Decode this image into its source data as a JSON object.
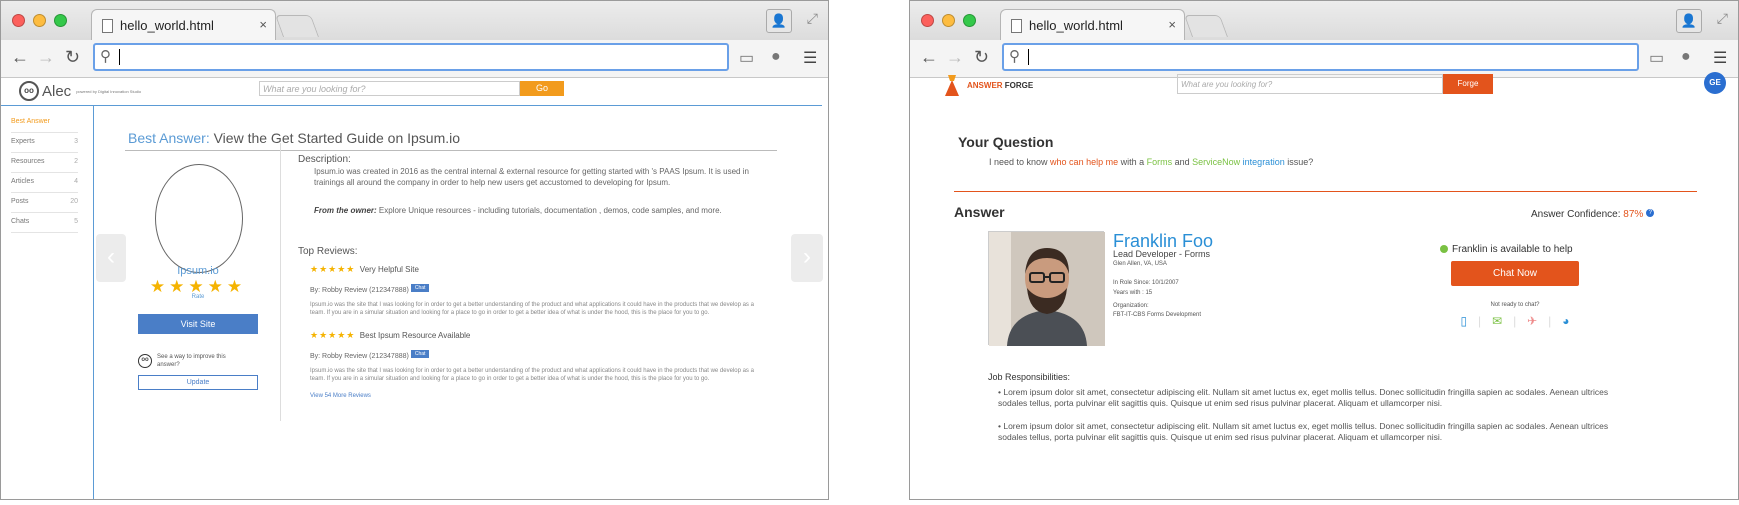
{
  "browser": {
    "tab_title": "hello_world.html",
    "tab_close": "×"
  },
  "alec": {
    "logo_name": "Alec",
    "logo_tagline": "powered by Digital Innovation Studio",
    "search_placeholder": "What are you looking for?",
    "go_label": "Go",
    "sidebar": [
      {
        "label": "Best Answer",
        "count": ""
      },
      {
        "label": "Experts",
        "count": "3"
      },
      {
        "label": "Resources",
        "count": "2"
      },
      {
        "label": "Articles",
        "count": "4"
      },
      {
        "label": "Posts",
        "count": "20"
      },
      {
        "label": "Chats",
        "count": "5"
      }
    ],
    "title_prefix": "Best Answer:",
    "title_main": " View the Get Started Guide on Ipsum.io",
    "resource_name": "Ipsum.io",
    "rating_stars": "★★★★★",
    "rating": 5,
    "rate_label": "Rate",
    "visit_label": "Visit Site",
    "improve_text": "See a way to improve this answer?",
    "update_label": "Update",
    "description_heading": "Description:",
    "description_body": "Ipsum.io was created in 2016 as the central internal & external resource for getting started with 's PAAS Ipsum.  It is used in trainings all around the company in order to help new users get accustomed to developing for Ipsum.",
    "owner_label": "From the owner:",
    "owner_text": " Explore Unique resources - including tutorials, documentation , demos, code samples, and more.",
    "reviews_heading": "Top Reviews:",
    "reviews": [
      {
        "stars": "★★★★★",
        "title": "Very Helpful Site",
        "by": "By: Robby Review (212347888)",
        "chat": "Chat",
        "body": "Ipsum.io was the site that I was looking for in order to get a better understanding of the product and what applications it could have in the products that we develop as a team.  If you are in a simular situation and looking for a place to go in order to get a better idea of what is under the hood, this is the place for you to go."
      },
      {
        "stars": "★★★★★",
        "title": "Best Ipsum Resource Available",
        "by": "By: Robby Review (212347888)",
        "chat": "Chat",
        "body": "Ipsum.io was the site that I was looking for in order to get a better understanding of the product and what applications it could have in the products that we develop as a team.  If you are in a simular situation and looking for a place to go in order to get a better idea of what is under the hood, this is the place for you to go."
      }
    ],
    "more_reviews": "View 54 More Reviews"
  },
  "forge": {
    "logo_a": "ANSWER",
    "logo_b": " FORGE",
    "search_placeholder": "What are you looking for?",
    "forge_label": "Forge",
    "ge_logo": "GE",
    "question_heading": "Your Question",
    "question": {
      "p1": "I need to know ",
      "p2": "who can help me",
      "p3": " with a ",
      "p4": "Forms",
      "p5": " and ",
      "p6": "ServiceNow",
      "p7": " ",
      "p8": "integration",
      "p9": " issue?"
    },
    "answer_heading": "Answer",
    "confidence_label": "Answer Confidence: ",
    "confidence_value": "87%",
    "help_glyph": "?",
    "expert": {
      "name": "Franklin Foo",
      "role": "Lead Developer -  Forms",
      "location": "Glen Allen, VA, USA",
      "in_role_since": "In Role Since: 10/1/2007",
      "years_with": "Years with : 15",
      "org_label": "Organization:",
      "org_value": "FBT-IT-CBS Forms Development"
    },
    "availability": "Franklin is available to help",
    "chat_now": "Chat Now",
    "not_ready": "Not ready to chat?",
    "contact_icons": [
      "phone-icon",
      "email-icon",
      "messenger-icon",
      "globe-icon"
    ],
    "job_heading": "Job Responsibilities:",
    "job_items": [
      "• Lorem ipsum dolor sit amet, consectetur adipiscing elit. Nullam sit amet luctus ex, eget mollis tellus. Donec sollicitudin fringilla sapien ac sodales. Aenean ultrices sodales tellus, porta pulvinar elit sagittis quis. Quisque ut enim sed risus pulvinar placerat. Aliquam et ullamcorper nisi.",
      "• Lorem ipsum dolor sit amet, consectetur adipiscing elit. Nullam sit amet luctus ex, eget mollis tellus. Donec sollicitudin fringilla sapien ac sodales. Aenean ultrices sodales tellus, porta pulvinar elit sagittis quis. Quisque ut enim sed risus pulvinar placerat. Aliquam et ullamcorper nisi."
    ]
  },
  "colors": {
    "alec_accent": "#5b9bd5",
    "alec_orange": "#f29b1d",
    "forge_orange": "#e3541c",
    "forge_blue": "#2a8fd6",
    "available_green": "#7ac143"
  }
}
